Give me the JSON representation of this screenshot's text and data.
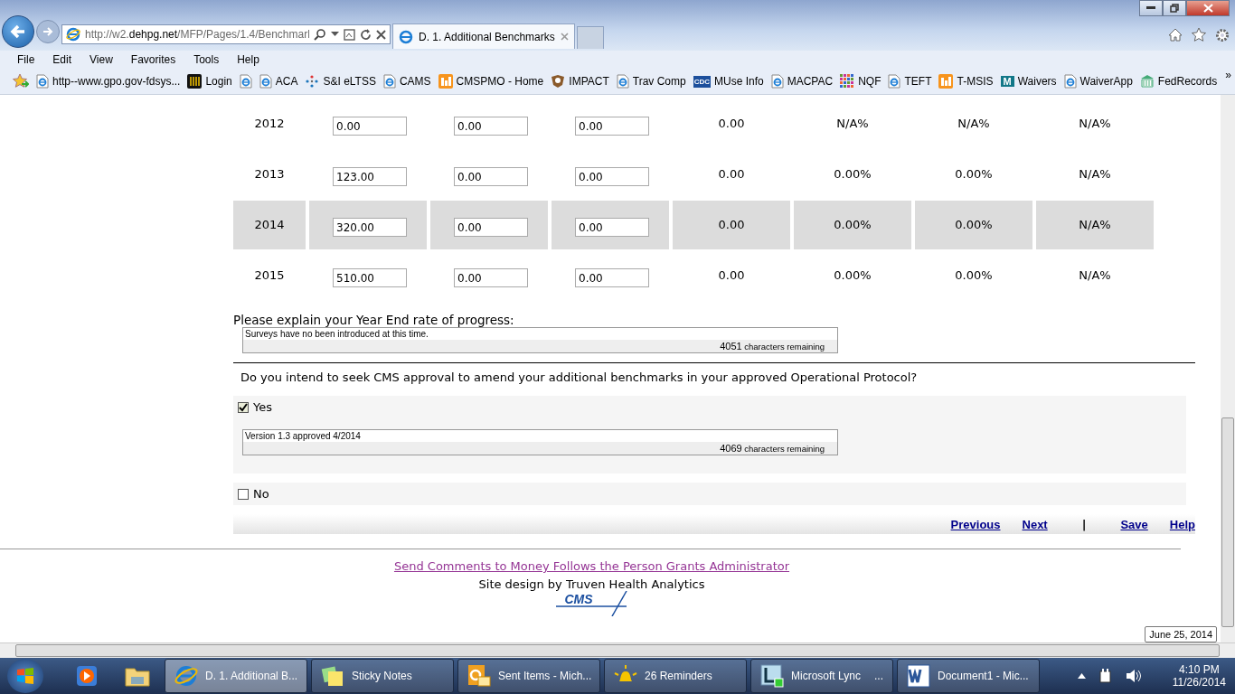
{
  "browser": {
    "address": "http://w2.**dehpg.net**/MFP/Pages/1.4/Benchmarl",
    "tabs": [
      {
        "label": "D. 1. Additional Benchmarks",
        "selected": true
      }
    ],
    "menu": [
      "File",
      "Edit",
      "View",
      "Favorites",
      "Tools",
      "Help"
    ],
    "favorites": [
      {
        "kind": "ie",
        "label": "http--www.gpo.gov-fdsys..."
      },
      {
        "kind": "login",
        "label": "Login"
      },
      {
        "kind": "ie"
      },
      {
        "kind": "ie",
        "label": "ACA"
      },
      {
        "kind": "dots",
        "label": "S&I eLTSS"
      },
      {
        "kind": "ie",
        "label": "CAMS"
      },
      {
        "kind": "orange",
        "label": "CMSPMO - Home"
      },
      {
        "kind": "seal",
        "label": "IMPACT"
      },
      {
        "kind": "ie",
        "label": "Trav Comp"
      },
      {
        "kind": "cdc",
        "label": "MUse Info",
        "badge": "CDC"
      },
      {
        "kind": "ie",
        "label": "MACPAC"
      },
      {
        "kind": "grid",
        "label": "NQF"
      },
      {
        "kind": "ie",
        "label": "TEFT"
      },
      {
        "kind": "orange",
        "label": "T-MSIS"
      },
      {
        "kind": "m",
        "label": "Waivers",
        "badge": "M"
      },
      {
        "kind": "ie",
        "label": "WaiverApp"
      },
      {
        "kind": "building",
        "label": "FedRecords"
      }
    ],
    "more": "»"
  },
  "table": {
    "rows": [
      {
        "year": "2012",
        "inputs": [
          "0.00",
          "0.00",
          "0.00"
        ],
        "values": [
          "0.00",
          "N/A%",
          "N/A%",
          "N/A%"
        ],
        "highlighted": false
      },
      {
        "year": "2013",
        "inputs": [
          "123.00",
          "0.00",
          "0.00"
        ],
        "values": [
          "0.00",
          "0.00%",
          "0.00%",
          "N/A%"
        ],
        "highlighted": false
      },
      {
        "year": "2014",
        "inputs": [
          "320.00",
          "0.00",
          "0.00"
        ],
        "values": [
          "0.00",
          "0.00%",
          "0.00%",
          "N/A%"
        ],
        "highlighted": true
      },
      {
        "year": "2015",
        "inputs": [
          "510.00",
          "0.00",
          "0.00"
        ],
        "values": [
          "0.00",
          "0.00%",
          "0.00%",
          "N/A%"
        ],
        "highlighted": false
      }
    ]
  },
  "progress": {
    "label": "Please explain your Year End rate of progress:",
    "value": "Surveys have no been introduced at this time.",
    "remaining": "4051",
    "remaining_label": "characters remaining"
  },
  "question": "Do you intend to seek CMS approval to amend your additional benchmarks in your approved Operational Protocol?",
  "options": [
    {
      "label": "Yes",
      "checked": true,
      "value": "Version 1.3 approved 4/2014",
      "remaining": "4069",
      "remaining_label": "characters remaining"
    },
    {
      "label": "No",
      "checked": false
    }
  ],
  "nav": [
    "Previous",
    "Next",
    "|",
    "Save",
    "Help"
  ],
  "footer": {
    "link": "Send Comments to Money Follows the Person Grants Administrator",
    "credit": "Site design by Truven Health Analytics",
    "logo": "CMS"
  },
  "tooltip": "June 25, 2014",
  "taskbar": {
    "windows": [
      {
        "kind": "ie",
        "label": "D. 1. Additional B...",
        "selected": true
      },
      {
        "kind": "sticky",
        "label": "Sticky Notes",
        "selected": false
      },
      {
        "kind": "outlook",
        "label": "Sent Items - Mich...",
        "selected": false
      },
      {
        "kind": "bell",
        "label": "26 Reminders",
        "selected": false
      },
      {
        "kind": "lync",
        "label": "Microsoft Lync",
        "extra": "...",
        "selected": false
      },
      {
        "kind": "word",
        "label": "Document1 - Mic...",
        "selected": false
      }
    ],
    "time": "4:10 PM",
    "date": "11/26/2014"
  }
}
